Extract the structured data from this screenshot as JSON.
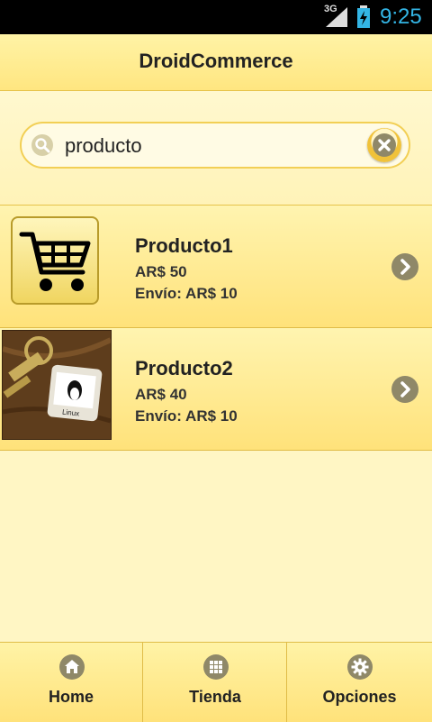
{
  "status_bar": {
    "network": "3G",
    "time": "9:25"
  },
  "header": {
    "title": "DroidCommerce"
  },
  "search": {
    "value": "producto"
  },
  "products": [
    {
      "name": "Producto1",
      "price": "AR$ 50",
      "shipping": "Envío: AR$ 10",
      "thumbnail": "shopping-cart-icon"
    },
    {
      "name": "Producto2",
      "price": "AR$ 40",
      "shipping": "Envío: AR$ 10",
      "thumbnail": "linux-keychain-photo"
    }
  ],
  "bottom_nav": [
    {
      "label": "Home",
      "icon": "home-icon"
    },
    {
      "label": "Tienda",
      "icon": "grid-icon"
    },
    {
      "label": "Opciones",
      "icon": "gear-icon"
    }
  ],
  "colors": {
    "accent": "#33b5e5",
    "header_bg": "#ffe680",
    "icon_gray": "#8c8468"
  }
}
